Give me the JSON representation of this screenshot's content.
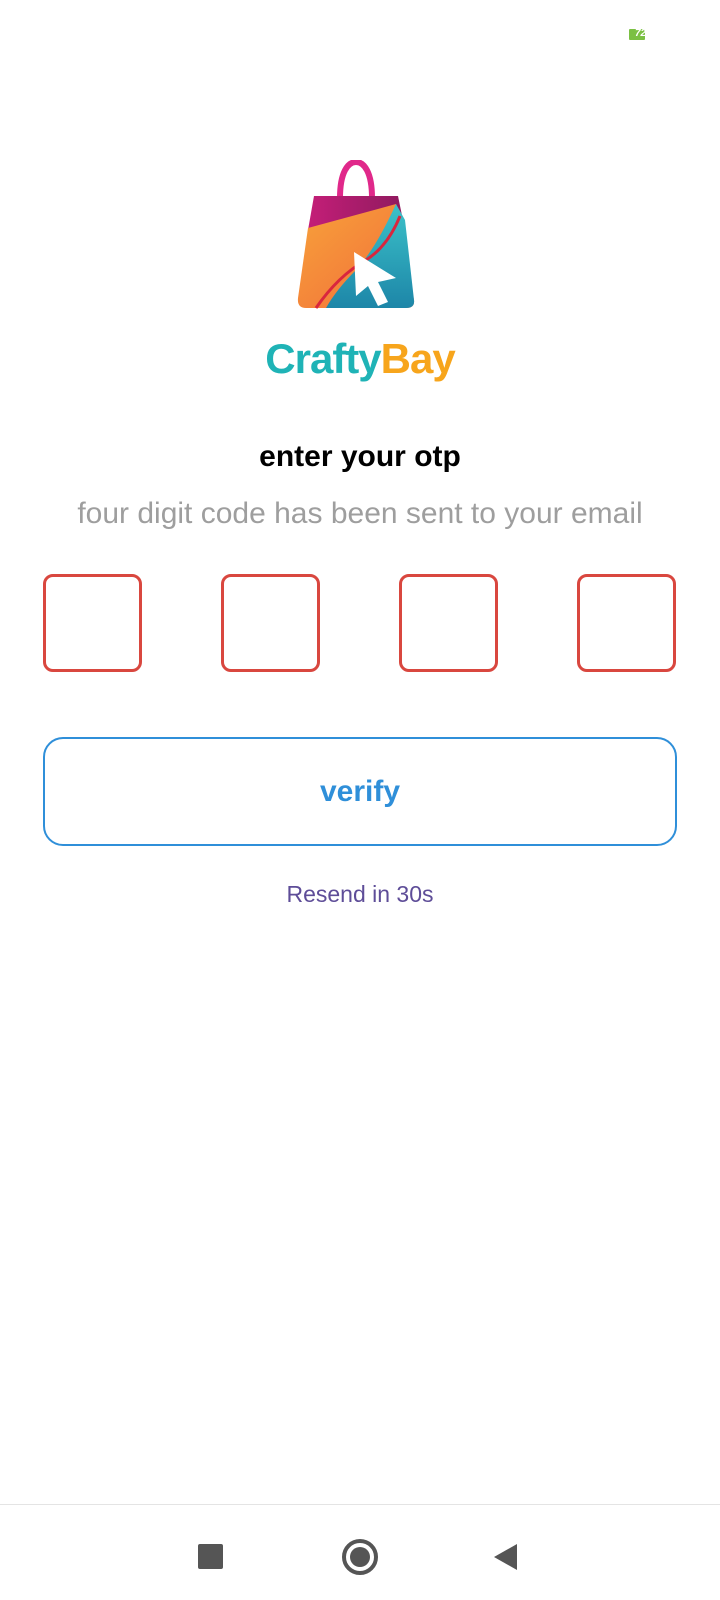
{
  "status_bar": {
    "battery_level": "72",
    "battery_color": "#7bc043"
  },
  "logo": {
    "icon": "shopping-bag-cursor-icon",
    "brand_first": "Crafty",
    "brand_second": "Bay",
    "brand_first_color": "#1fb3b6",
    "brand_second_color": "#f7a51c"
  },
  "otp": {
    "title": "enter your otp",
    "subtitle": "four digit code has been sent to your email",
    "digits": [
      "",
      "",
      "",
      ""
    ],
    "box_color": "#d9473f"
  },
  "verify_button": {
    "label": "verify",
    "color": "#2f8fd9"
  },
  "resend": {
    "label": "Resend in 30s",
    "color": "#5e4d98"
  },
  "nav_bar": {
    "recents_icon": "square-icon",
    "home_icon": "circle-icon",
    "back_icon": "triangle-back-icon"
  }
}
